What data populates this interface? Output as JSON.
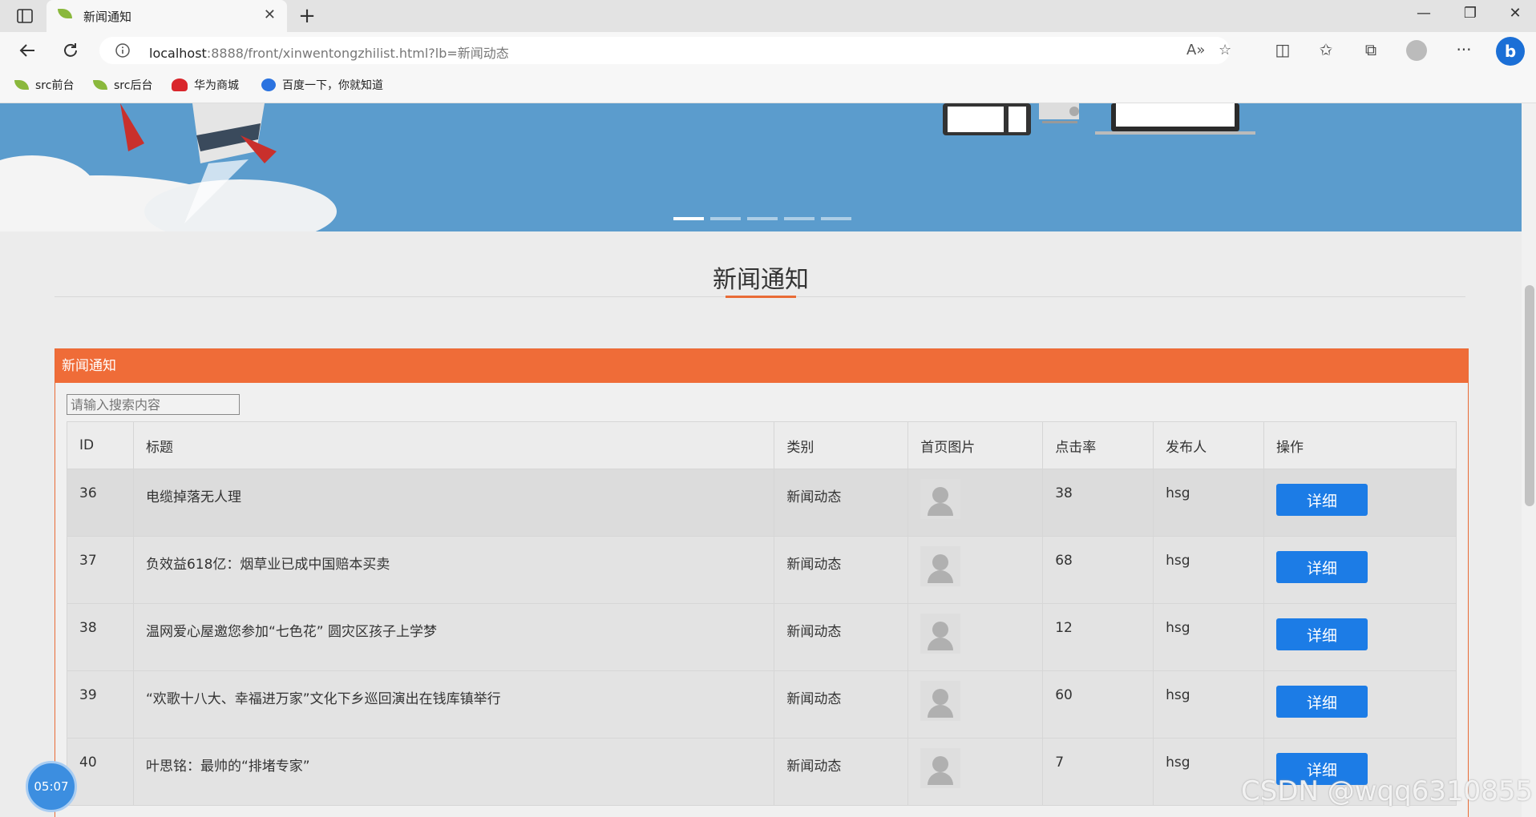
{
  "browser": {
    "tab_title": "新闻通知",
    "url_host": "localhost",
    "url_rest": ":8888/front/xinwentongzhilist.html?lb=新闻动态"
  },
  "bookmarks": [
    {
      "label": "src前台",
      "icon": "leaf-icon"
    },
    {
      "label": "src后台",
      "icon": "leaf-icon"
    },
    {
      "label": "华为商城",
      "icon": "huawei-icon"
    },
    {
      "label": "百度一下，你就知道",
      "icon": "baidu-paw-icon"
    }
  ],
  "page": {
    "section_title": "新闻通知",
    "panel_title": "新闻通知",
    "search_placeholder": "请输入搜索内容"
  },
  "table": {
    "headers": [
      "ID",
      "标题",
      "类别",
      "首页图片",
      "点击率",
      "发布人",
      "操作"
    ],
    "rows": [
      {
        "id": "36",
        "title": "电缆掉落无人理",
        "category": "新闻动态",
        "clicks": "38",
        "publisher": "hsg",
        "action": "详细"
      },
      {
        "id": "37",
        "title": "负效益618亿：烟草业已成中国赔本买卖",
        "category": "新闻动态",
        "clicks": "68",
        "publisher": "hsg",
        "action": "详细"
      },
      {
        "id": "38",
        "title": "温网爱心屋邀您参加“七色花” 圆灾区孩子上学梦",
        "category": "新闻动态",
        "clicks": "12",
        "publisher": "hsg",
        "action": "详细"
      },
      {
        "id": "39",
        "title": "“欢歌十八大、幸福进万家”文化下乡巡回演出在钱库镇举行",
        "category": "新闻动态",
        "clicks": "60",
        "publisher": "hsg",
        "action": "详细"
      },
      {
        "id": "40",
        "title": "叶思铭：最帅的“排堵专家”",
        "category": "新闻动态",
        "clicks": "7",
        "publisher": "hsg",
        "action": "详细"
      }
    ]
  },
  "overlay": {
    "clock": "05:07",
    "watermark": "CSDN @wqq6310855"
  },
  "colors": {
    "accent": "#ef6c38",
    "button": "#1c7ce6",
    "banner": "#5b9ccd"
  }
}
